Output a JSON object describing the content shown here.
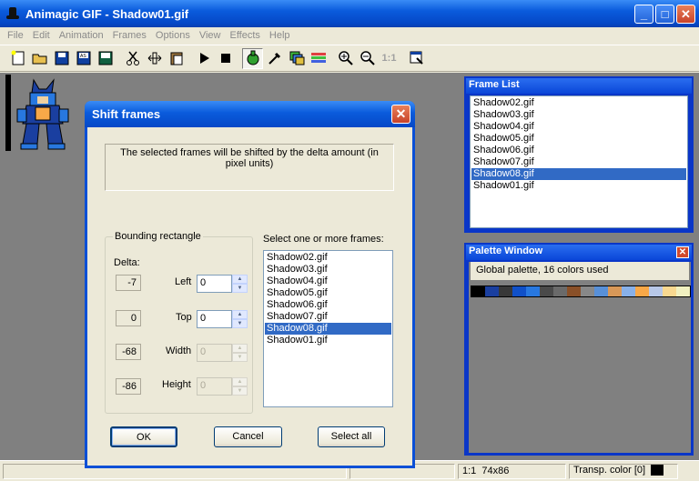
{
  "app": {
    "title": "Animagic GIF - Shadow01.gif",
    "menu": [
      "File",
      "Edit",
      "Animation",
      "Frames",
      "Options",
      "View",
      "Effects",
      "Help"
    ],
    "window_buttons": [
      "minimize-icon",
      "maximize-icon",
      "close-icon"
    ],
    "toolbar_icons": [
      "new-icon",
      "open-icon",
      "save-icon",
      "save-as-icon",
      "save-all-icon",
      "cut-icon",
      "resize-icon",
      "paste-icon",
      "play-icon",
      "stop-icon",
      "transparency-icon",
      "eyedropper-icon",
      "frames-icon",
      "palette-icon",
      "zoom-in-icon",
      "zoom-out-icon",
      "actual-size-icon",
      "properties-icon"
    ],
    "toolbar_actual_size": "1:1"
  },
  "frame_list_panel": {
    "title": "Frame List",
    "items": [
      "Shadow02.gif",
      "Shadow03.gif",
      "Shadow04.gif",
      "Shadow05.gif",
      "Shadow06.gif",
      "Shadow07.gif",
      "Shadow08.gif",
      "Shadow01.gif"
    ],
    "selected": "Shadow08.gif"
  },
  "palette_panel": {
    "title": "Palette Window",
    "info": "Global palette, 16 colors used",
    "colors": [
      "#000000",
      "#1a3fa0",
      "#383838",
      "#1050c8",
      "#2878e0",
      "#4a4a4a",
      "#6a6a6a",
      "#8a5028",
      "#888888",
      "#5890d8",
      "#d89858",
      "#88b0e8",
      "#f8a848",
      "#b8c8e8",
      "#f8d890",
      "#f0f0c0"
    ]
  },
  "dialog": {
    "title": "Shift frames",
    "info": "The selected frames will be shifted by the delta amount (in pixel units)",
    "group_label": "Bounding rectangle",
    "delta_label": "Delta:",
    "rows": [
      {
        "label": "Left",
        "delta": "-7",
        "value": "0",
        "enabled": true
      },
      {
        "label": "Top",
        "delta": "0",
        "value": "0",
        "enabled": true
      },
      {
        "label": "Width",
        "delta": "-68",
        "value": "0",
        "enabled": false
      },
      {
        "label": "Height",
        "delta": "-86",
        "value": "0",
        "enabled": false
      }
    ],
    "frames_label": "Select one or more frames:",
    "frames": [
      "Shadow02.gif",
      "Shadow03.gif",
      "Shadow04.gif",
      "Shadow05.gif",
      "Shadow06.gif",
      "Shadow07.gif",
      "Shadow08.gif",
      "Shadow01.gif"
    ],
    "selected_frame": "Shadow08.gif",
    "ok": "OK",
    "cancel": "Cancel",
    "select_all": "Select all"
  },
  "status": {
    "zoom": "1:1",
    "size": "74x86",
    "transp": "Transp. color [0]"
  }
}
